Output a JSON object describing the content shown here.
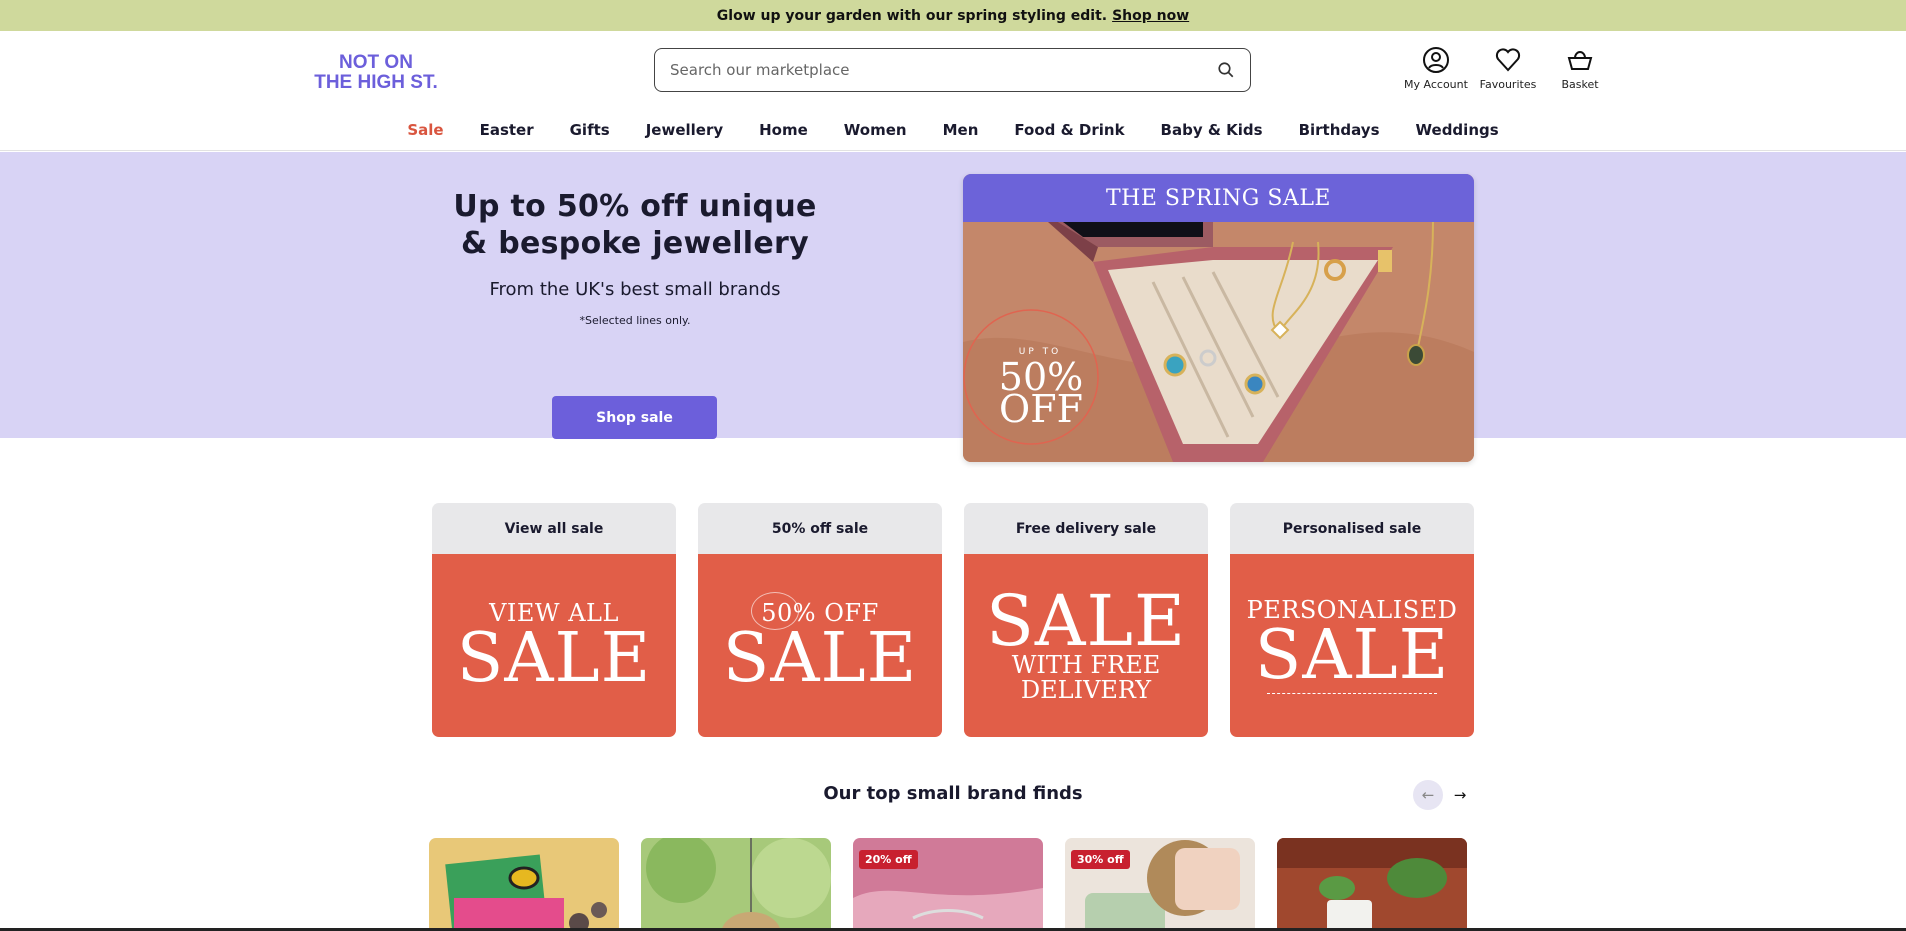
{
  "announcement": {
    "text": "Glow up your garden with our spring styling edit.",
    "link": "Shop now"
  },
  "header": {
    "logo_text_line1": "NOT ON",
    "logo_text_line2": "THE HIGH ST.",
    "search_placeholder": "Search our marketplace",
    "icons": [
      {
        "label": "My Account",
        "icon": "account-icon"
      },
      {
        "label": "Favourites",
        "icon": "heart-icon"
      },
      {
        "label": "Basket",
        "icon": "basket-icon"
      }
    ]
  },
  "nav": [
    "Sale",
    "Easter",
    "Gifts",
    "Jewellery",
    "Home",
    "Women",
    "Men",
    "Food & Drink",
    "Baby & Kids",
    "Birthdays",
    "Weddings"
  ],
  "hero": {
    "headline_line1": "Up to 50% off unique",
    "headline_line2": "& bespoke jewellery",
    "subheading": "From the UK's best small brands",
    "fineprint": "*Selected lines only.",
    "button": "Shop sale",
    "card_title": "THE SPRING SALE",
    "card_badge_small": "UP TO",
    "card_badge_pct": "50%",
    "card_badge_off": "OFF"
  },
  "tiles": [
    {
      "caption": "View all sale",
      "line1": "VIEW ALL",
      "line2": "SALE"
    },
    {
      "caption": "50% off sale",
      "line1": "50% OFF",
      "line2": "SALE"
    },
    {
      "caption": "Free delivery sale",
      "line1": "SALE",
      "line2": "WITH FREE",
      "line3": "DELIVERY"
    },
    {
      "caption": "Personalised sale",
      "line1": "PERSONALISED",
      "line2": "SALE"
    }
  ],
  "section": {
    "title": "Our top small brand finds",
    "prev": "←",
    "next": "→"
  },
  "products": [
    {
      "badge": ""
    },
    {
      "badge": ""
    },
    {
      "badge": "20% off"
    },
    {
      "badge": "30% off"
    },
    {
      "badge": ""
    }
  ],
  "colors": {
    "announce_bg": "#cfd99c",
    "hero_bg": "#d8d3f5",
    "brand_purple": "#6c5fdb",
    "sale_red": "#e15e48",
    "nav_sale": "#d9553f"
  }
}
